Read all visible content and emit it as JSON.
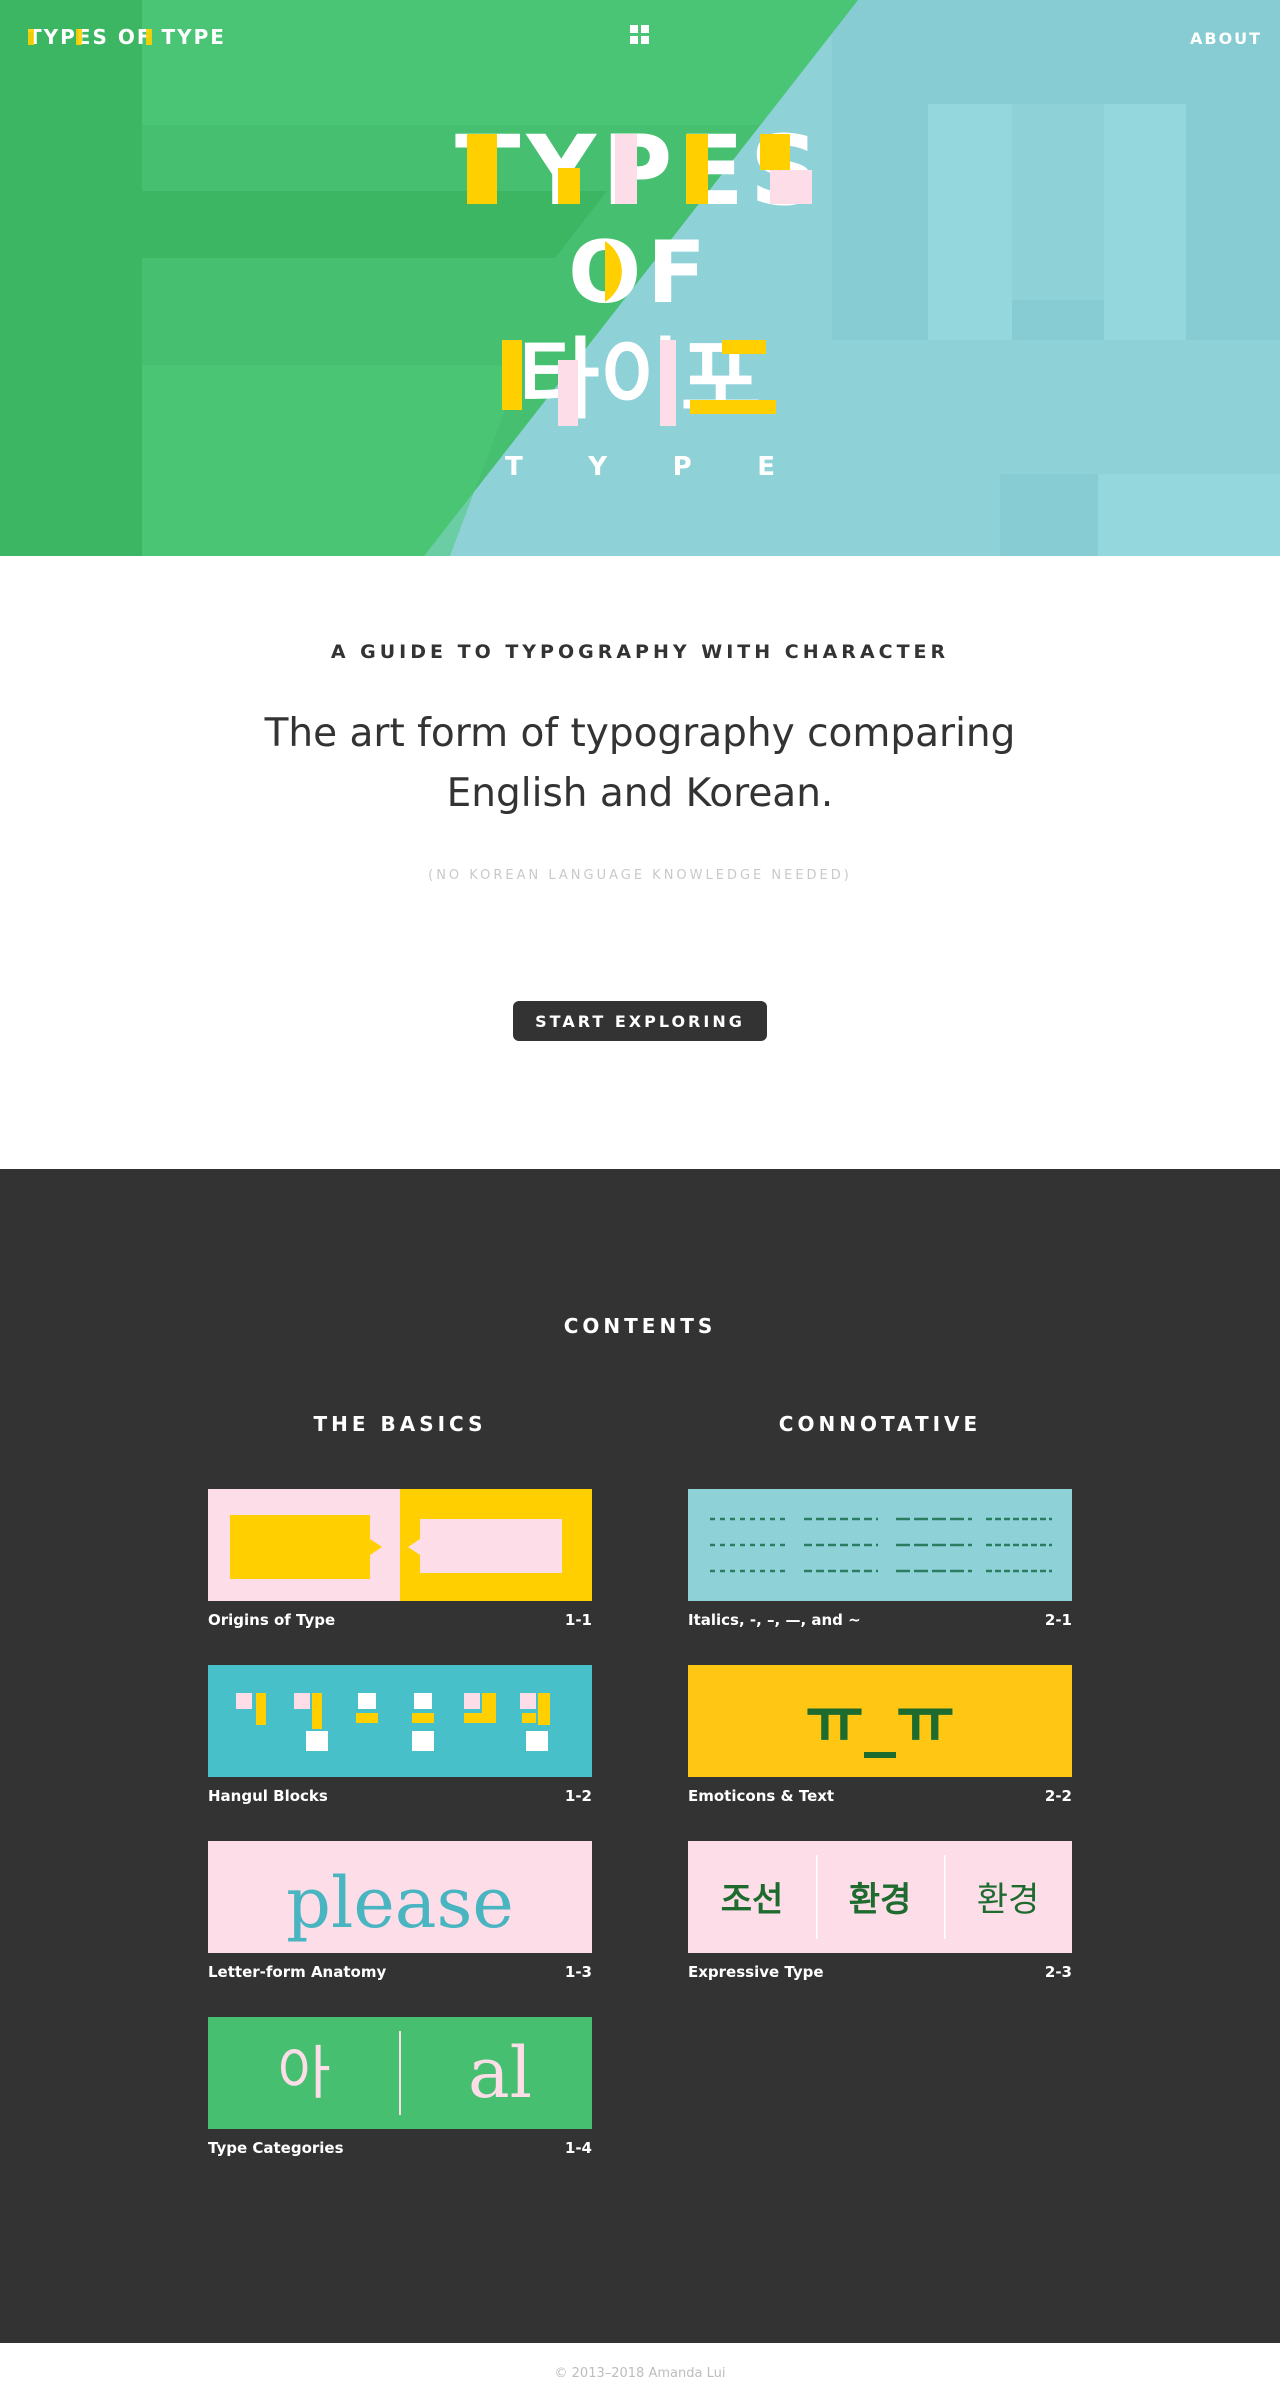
{
  "header": {
    "brand": "TYPES OF TYPE",
    "menu_icon": "grid-icon",
    "about_label": "ABOUT"
  },
  "hero": {
    "line1": "TYPES",
    "line2": "OF",
    "line3": "타이포",
    "subtitle": [
      "T",
      "Y",
      "P",
      "E"
    ],
    "colors": {
      "green": "#46c070",
      "dark_green": "#3cb663",
      "teal": "#8ed2d8",
      "yellow": "#ffcf00",
      "pink": "#fcdde8",
      "white": "#ffffff"
    }
  },
  "intro": {
    "kicker": "A GUIDE TO TYPOGRAPHY WITH CHARACTER",
    "lead": "The art form of typography comparing English and Korean.",
    "note": "(NO KOREAN LANGUAGE KNOWLEDGE NEEDED)",
    "cta": "START EXPLORING"
  },
  "contents": {
    "title": "CONTENTS",
    "basics": {
      "title": "THE BASICS",
      "items": [
        {
          "label": "Origins of Type",
          "num": "1-1"
        },
        {
          "label": "Hangul Blocks",
          "num": "1-2"
        },
        {
          "label": "Letter-form Anatomy",
          "num": "1-3",
          "thumb_text": "please"
        },
        {
          "label": "Type Categories",
          "num": "1-4",
          "thumb_text_left": "아",
          "thumb_text_right": "al"
        }
      ]
    },
    "connotative": {
      "title": "CONNOTATIVE",
      "items": [
        {
          "label": "Italics, -, –, —, and ~",
          "num": "2-1"
        },
        {
          "label": "Emoticons & Text",
          "num": "2-2",
          "thumb_text": "ㅠ_ㅠ"
        },
        {
          "label": "Expressive Type",
          "num": "2-3",
          "thumb_words": [
            "조선",
            "환경",
            "환경"
          ]
        }
      ]
    }
  },
  "footer": {
    "copyright": "© 2013–2018 Amanda Lui"
  }
}
